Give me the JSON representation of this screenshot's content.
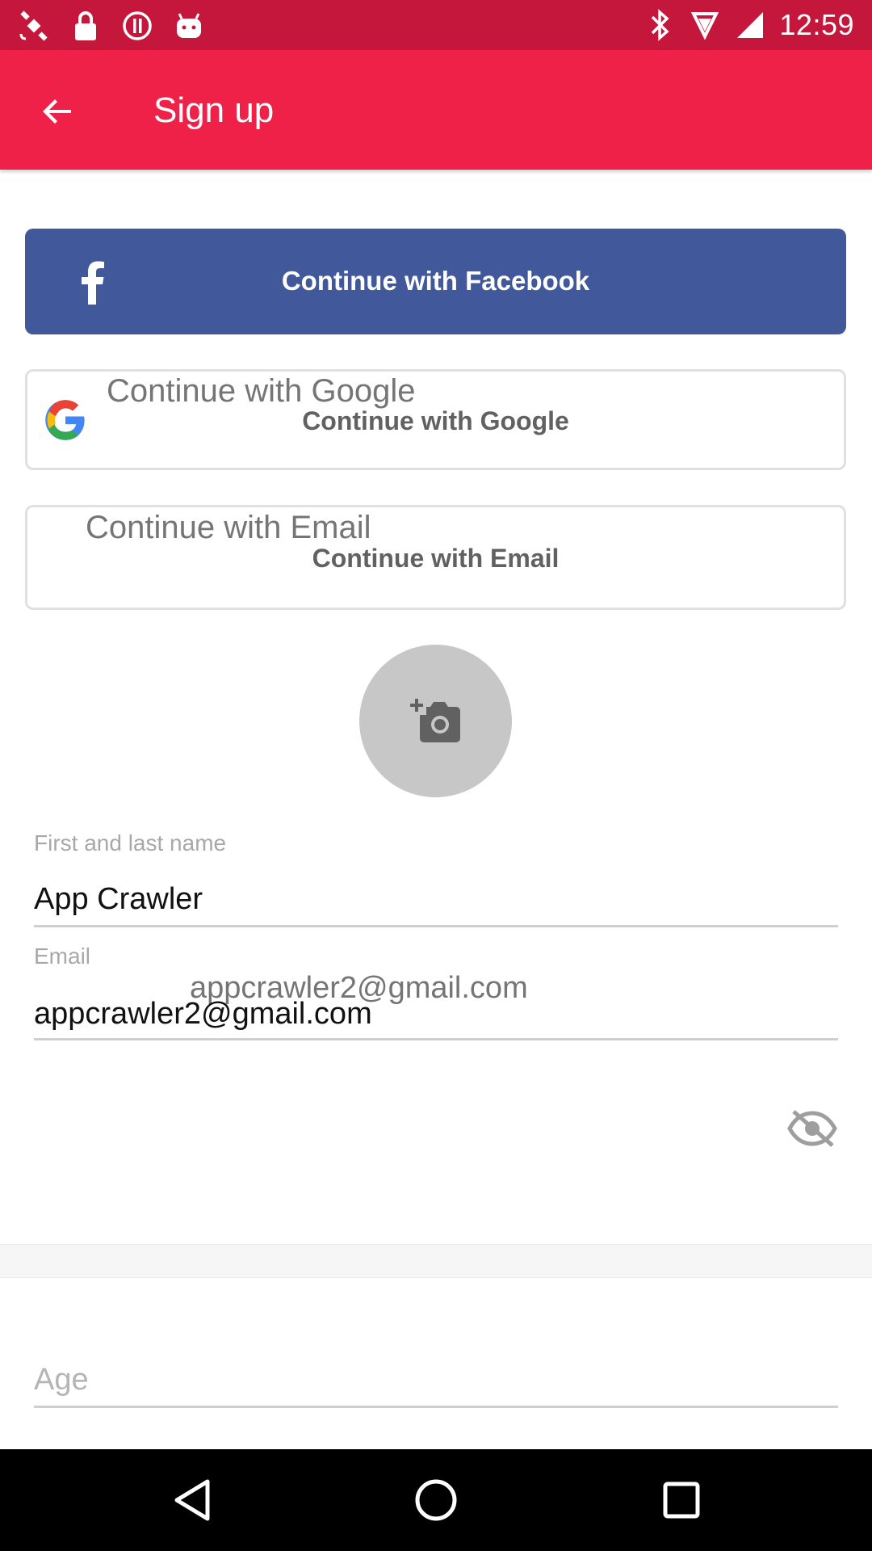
{
  "status_bar": {
    "time": "12:59",
    "left_icons": [
      "satellite-icon",
      "lock-icon",
      "alert-icon",
      "android-icon"
    ],
    "right_icons": [
      "bluetooth-icon",
      "vibrate-icon",
      "signal-icon"
    ]
  },
  "app_bar": {
    "title": "Sign up",
    "background_color": "#ef2149",
    "status_color": "#c5173b"
  },
  "buttons": {
    "facebook_label": "Continue with Facebook",
    "facebook_color": "#41599b",
    "google_hint": "Continue with Google",
    "google_label": "Continue with Google",
    "email_hint": "Continue with Email",
    "email_label": "Continue with Email"
  },
  "form": {
    "name_label": "First and last name",
    "name_value": "App Crawler",
    "email_label": "Email",
    "email_hint": "appcrawler2@gmail.com",
    "email_value": "appcrawler2@gmail.com",
    "age_placeholder": "Age"
  }
}
